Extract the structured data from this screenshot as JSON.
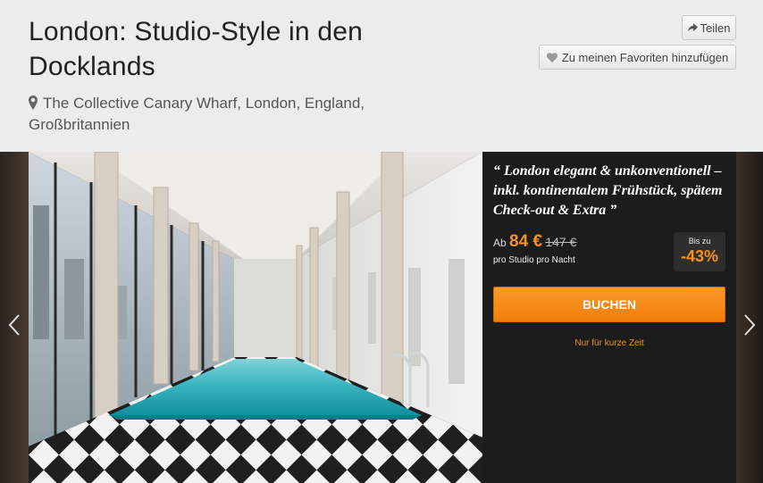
{
  "header": {
    "title": "London: Studio-Style in den Docklands",
    "location": "The Collective Canary Wharf, London, England, Großbritannien"
  },
  "actions": {
    "share_label": "Teilen",
    "favorite_label": "Zu meinen Favoriten hinzufügen"
  },
  "gallery": {
    "prev_icon": "chevron-left-icon",
    "next_icon": "chevron-right-icon"
  },
  "offer": {
    "quote": "“ London elegant & unkonventionell – inkl. kontinentalem Frühstück, spätem Check-out & Extra ”",
    "price_prefix": "Ab",
    "price": "84 €",
    "old_price": "147 €",
    "price_unit": "pro Studio pro Nacht",
    "discount_label": "Bis zu",
    "discount_value": "-43%",
    "book_label": "BUCHEN",
    "limited_note": "Nur für kurze Zeit"
  },
  "colors": {
    "accent": "#f7901e",
    "panel_bg": "#1c1c1c",
    "header_bg": "#ececec"
  }
}
